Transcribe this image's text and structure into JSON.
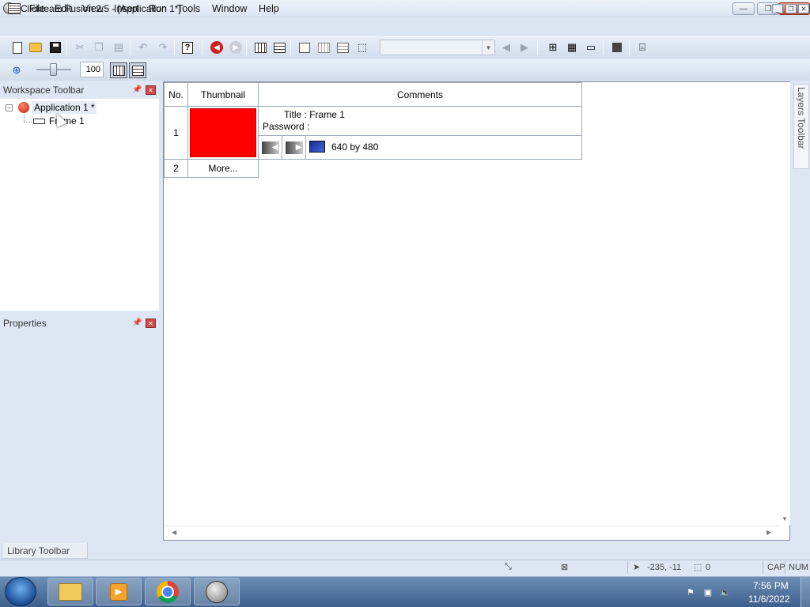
{
  "window": {
    "title": "Clickteam Fusion 2.5 - [Application 1*]",
    "minimize": "—",
    "maximize": "❐",
    "close": "✕"
  },
  "menu": {
    "items": [
      "File",
      "Edit",
      "View",
      "Insert",
      "Run",
      "Tools",
      "Window",
      "Help"
    ]
  },
  "toolbar": {
    "zoom_value": "100",
    "zoom_level": 0.5
  },
  "workspace": {
    "title": "Workspace Toolbar",
    "tree": {
      "application": "Application 1 *",
      "frame": "Frame 1",
      "collapse": "−"
    }
  },
  "properties": {
    "title": "Properties"
  },
  "library": {
    "tab": "Library Toolbar"
  },
  "layers": {
    "tab": "Layers Toolbar"
  },
  "storyboard": {
    "headers": {
      "no": "No.",
      "thumbnail": "Thumbnail",
      "comments": "Comments"
    },
    "rows": [
      {
        "no": "1",
        "thumbnail_color": "#ff0000",
        "title_line": "Title : Frame 1",
        "password_line": "Password :",
        "resolution": "640  by 480"
      },
      {
        "no": "2",
        "more": "More..."
      }
    ]
  },
  "status": {
    "coords": "-235, -11",
    "count": "0",
    "caps": "CAP",
    "num": "NUM"
  },
  "taskbar": {
    "time": "7:56 PM",
    "date": "11/6/2022"
  }
}
